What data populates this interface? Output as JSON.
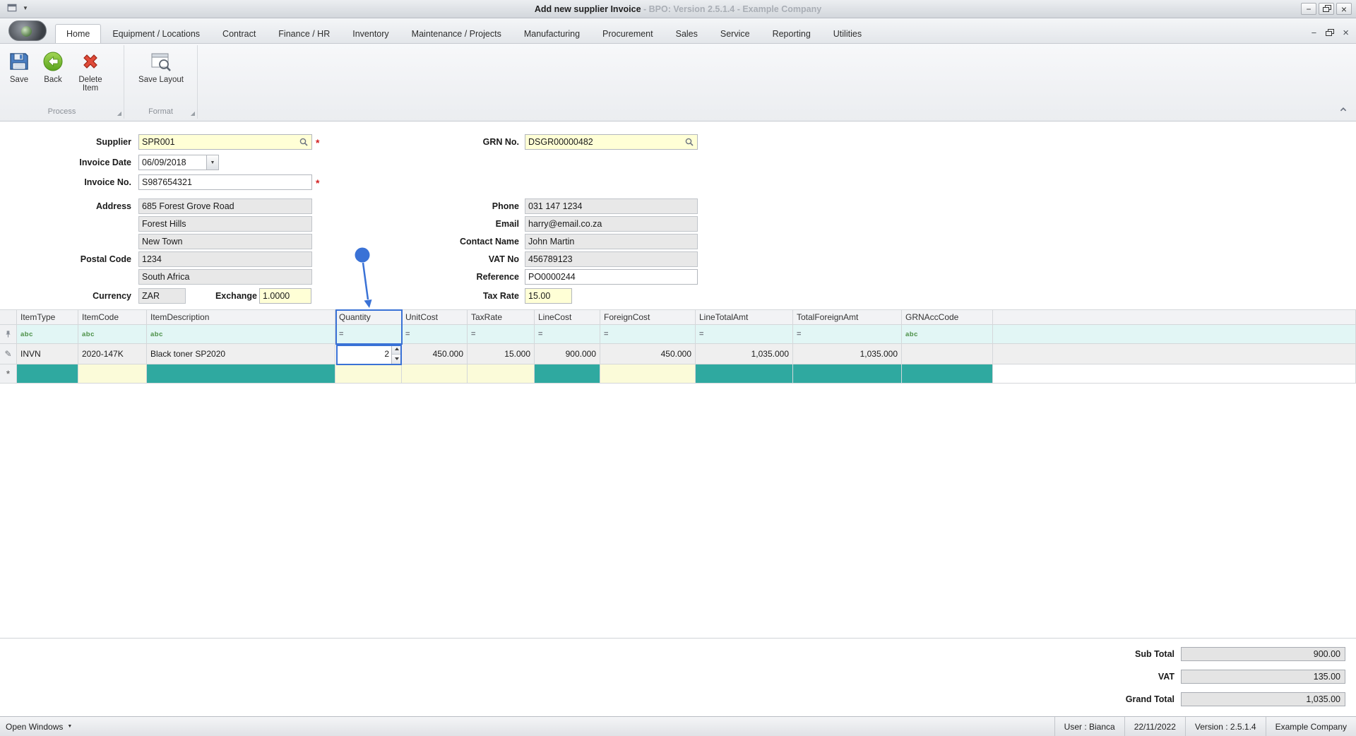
{
  "window": {
    "title_main": "Add new supplier Invoice",
    "title_rest": " - BPO: Version 2.5.1.4 - Example Company"
  },
  "tabs": [
    "Home",
    "Equipment / Locations",
    "Contract",
    "Finance / HR",
    "Inventory",
    "Maintenance / Projects",
    "Manufacturing",
    "Procurement",
    "Sales",
    "Service",
    "Reporting",
    "Utilities"
  ],
  "ribbon": {
    "save": "Save",
    "back": "Back",
    "delete_item": "Delete Item",
    "save_layout": "Save Layout",
    "group_process": "Process",
    "group_format": "Format"
  },
  "form": {
    "supplier": {
      "label": "Supplier",
      "value": "SPR001"
    },
    "invoice_date": {
      "label": "Invoice Date",
      "value": "06/09/2018"
    },
    "invoice_no": {
      "label": "Invoice No.",
      "value": "S987654321"
    },
    "address": {
      "label": "Address",
      "line1": "685 Forest Grove Road",
      "line2": "Forest Hills",
      "line3": "New Town"
    },
    "postal_code": {
      "label": "Postal Code",
      "value": "1234"
    },
    "country": "South Africa",
    "currency": {
      "label": "Currency",
      "value": "ZAR"
    },
    "exchange": {
      "label": "Exchange",
      "value": "1.0000"
    },
    "grn_no": {
      "label": "GRN No.",
      "value": "DSGR00000482"
    },
    "phone": {
      "label": "Phone",
      "value": "031 147 1234"
    },
    "email": {
      "label": "Email",
      "value": "harry@email.co.za"
    },
    "contact_name": {
      "label": "Contact Name",
      "value": "John Martin"
    },
    "vat_no": {
      "label": "VAT No",
      "value": "456789123"
    },
    "reference": {
      "label": "Reference",
      "value": "PO0000244"
    },
    "tax_rate": {
      "label": "Tax Rate",
      "value": "15.00"
    }
  },
  "grid": {
    "columns": [
      "ItemType",
      "ItemCode",
      "ItemDescription",
      "Quantity",
      "UnitCost",
      "TaxRate",
      "LineCost",
      "ForeignCost",
      "LineTotalAmt",
      "TotalForeignAmt",
      "GRNAccCode"
    ],
    "row": {
      "cells": [
        "INVN",
        "2020-147K",
        "Black toner SP2020",
        "2",
        "450.000",
        "15.000",
        "900.000",
        "450.000",
        "1,035.000",
        "1,035.000",
        ""
      ]
    }
  },
  "totals": {
    "sub_total": {
      "label": "Sub Total",
      "value": "900.00"
    },
    "vat": {
      "label": "VAT",
      "value": "135.00"
    },
    "grand_total": {
      "label": "Grand Total",
      "value": "1,035.00"
    }
  },
  "status_bar": {
    "open_windows": "Open Windows",
    "user": "User : Bianca",
    "date": "22/11/2022",
    "version": "Version : 2.5.1.4",
    "company": "Example Company"
  },
  "icons": {
    "caret_down": "▼",
    "required_asterisk": "*",
    "edit_pencil": "✎",
    "new_row_asterisk": "*",
    "text_filter": "abc",
    "numeric_filter": "=",
    "minimize": "−",
    "close": "×"
  }
}
